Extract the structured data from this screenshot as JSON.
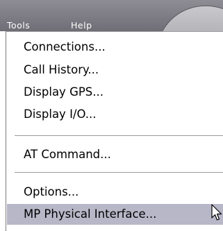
{
  "menubar": {
    "items": [
      {
        "label": "Tools"
      },
      {
        "label": "Help"
      }
    ]
  },
  "dropdown": {
    "items": [
      {
        "label": "Connections..."
      },
      {
        "label": "Call History..."
      },
      {
        "label": "Display GPS..."
      },
      {
        "label": "Display I/O..."
      },
      {
        "label": "AT Command..."
      },
      {
        "label": "Options..."
      },
      {
        "label": "MP Physical Interface..."
      }
    ],
    "highlighted_item": "MP Physical Interface..."
  },
  "colors": {
    "menubar": "#7f7e86",
    "highlight": "#b8b7c8"
  },
  "icons": [
    "mouse-pointer-icon"
  ]
}
